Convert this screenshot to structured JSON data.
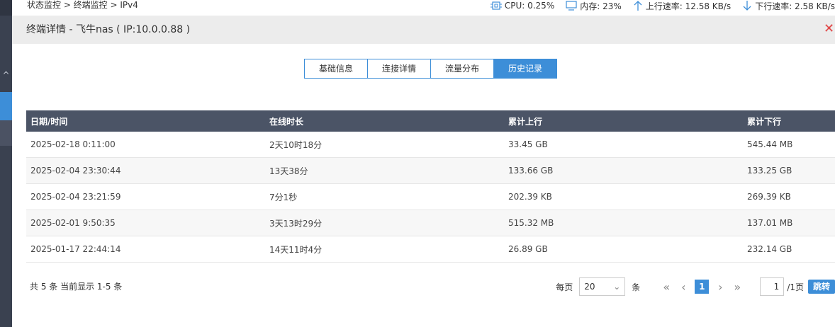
{
  "breadcrumb": {
    "text": "状态监控 > 终端监控 > IPv4"
  },
  "stats": {
    "cpu": "CPU: 0.25%",
    "mem": "内存: 23%",
    "up": "上行速率: 12.58 KB/s",
    "down": "下行速率: 2.58 KB/s"
  },
  "header": {
    "title": "终端详情 - 飞牛nas ( IP:10.0.0.88 )",
    "close": "✕"
  },
  "tabs": [
    {
      "label": "基础信息"
    },
    {
      "label": "连接详情"
    },
    {
      "label": "流量分布"
    },
    {
      "label": "历史记录"
    }
  ],
  "table": {
    "headers": [
      "日期/时间",
      "在线时长",
      "累计上行",
      "累计下行"
    ],
    "rows": [
      [
        "2025-02-18 0:11:00",
        "2天10时18分",
        "33.45 GB",
        "545.44 MB"
      ],
      [
        "2025-02-04 23:30:44",
        "13天38分",
        "133.66 GB",
        "133.25 GB"
      ],
      [
        "2025-02-04 23:21:59",
        "7分1秒",
        "202.39 KB",
        "269.39 KB"
      ],
      [
        "2025-02-01 9:50:35",
        "3天13时29分",
        "515.32 MB",
        "137.01 MB"
      ],
      [
        "2025-01-17 22:44:14",
        "14天11时4分",
        "26.89 GB",
        "232.14 GB"
      ]
    ]
  },
  "footer": {
    "summary": "共 5 条 当前显示 1-5 条",
    "per_page_label": "每页",
    "per_page_value": "20",
    "per_page_unit": "条",
    "current_page": "1",
    "page_input": "1",
    "total_pages": "/1页",
    "go_label": "跳转"
  },
  "colors": {
    "accent": "#3d8ed8",
    "table_header": "#4b5466",
    "close": "#e04545"
  }
}
